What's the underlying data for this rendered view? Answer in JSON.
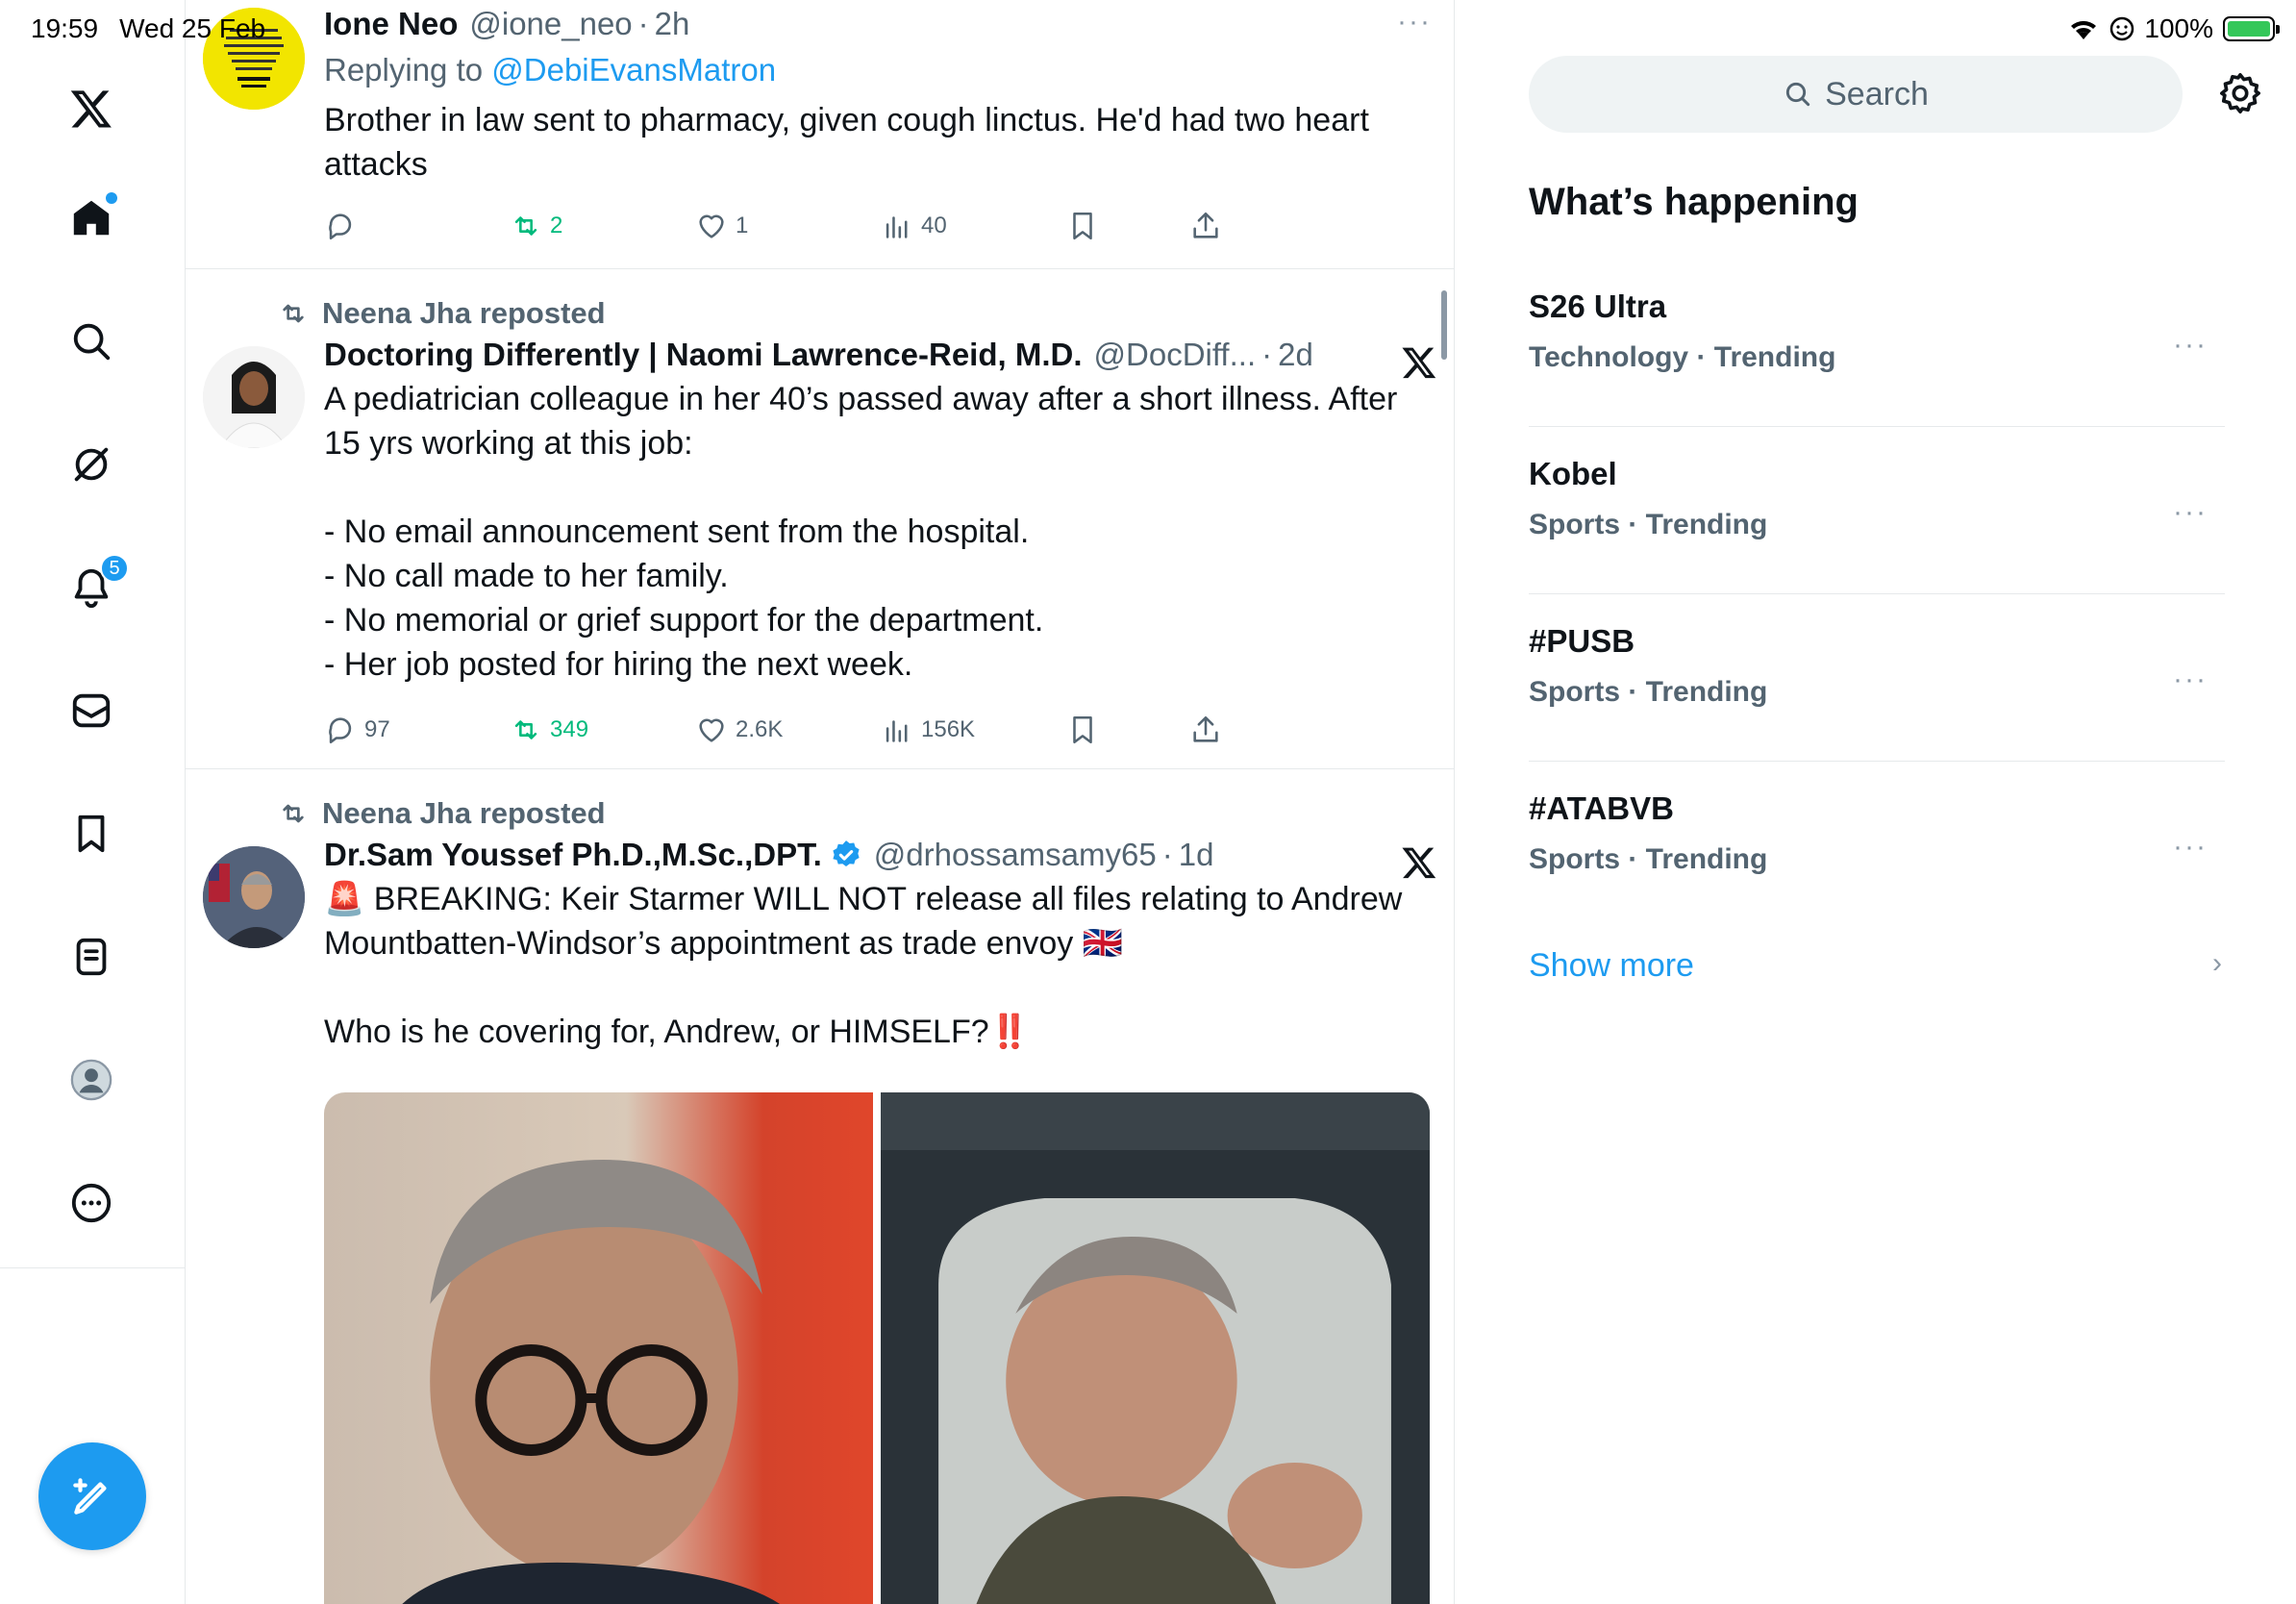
{
  "status_bar": {
    "time": "19:59",
    "date": "Wed 25 Feb",
    "battery": "100%"
  },
  "nav": {
    "items": [
      "x-logo",
      "home",
      "explore",
      "grok",
      "notifications",
      "messages",
      "bookmarks",
      "lists",
      "profile",
      "more"
    ],
    "notifications_badge": "5"
  },
  "tweets": [
    {
      "name": "Ione Neo",
      "handle": "@ione_neo",
      "sep": "·",
      "time": "2h",
      "reply_prefix": "Replying to ",
      "reply_handle": "@DebiEvansMatron",
      "text": "Brother in law sent to pharmacy, given cough linctus. He'd had two heart attacks",
      "more": "···",
      "retweets": "2",
      "likes": "1",
      "views": "40"
    },
    {
      "reposted_by": "Neena Jha reposted",
      "name": "Doctoring Differently | Naomi Lawrence-Reid, M.D.",
      "handle": "@DocDiff...",
      "sep": "·",
      "time": "2d",
      "text": "A pediatrician colleague in her 40’s passed away after a short illness. After 15 yrs working at this job:\n\n- No email announcement sent from the hospital.\n- No call made to her family.\n- No memorial or grief support for the department.\n- Her job posted for hiring the next week.",
      "replies": "97",
      "retweets": "349",
      "likes": "2.6K",
      "views": "156K"
    },
    {
      "reposted_by": "Neena Jha reposted",
      "name": "Dr.Sam Youssef Ph.D.,M.Sc.,DPT.",
      "handle": "@drhossamsamy65",
      "sep": "·",
      "time": "1d",
      "text_line1": "🚨 BREAKING: Keir Starmer WILL NOT release all files relating to Andrew Mountbatten-Windsor’s appointment as trade envoy 🇬🇧",
      "text_line2": "Who is he covering for, Andrew, or HIMSELF?‼️"
    }
  ],
  "sidebar": {
    "search_placeholder": "Search",
    "section_title": "What’s happening",
    "trends": [
      {
        "name": "S26 Ultra",
        "meta": "Technology · Trending"
      },
      {
        "name": "Kobel",
        "meta": "Sports · Trending"
      },
      {
        "name": "#PUSB",
        "meta": "Sports · Trending"
      },
      {
        "name": "#ATABVB",
        "meta": "Sports · Trending"
      }
    ],
    "trend_more": "···",
    "show_more": "Show more",
    "chevron": "›"
  },
  "colors": {
    "accent": "#1d9bf0",
    "retweet": "#00ba7c",
    "muted": "#536471",
    "text": "#0f1419"
  }
}
